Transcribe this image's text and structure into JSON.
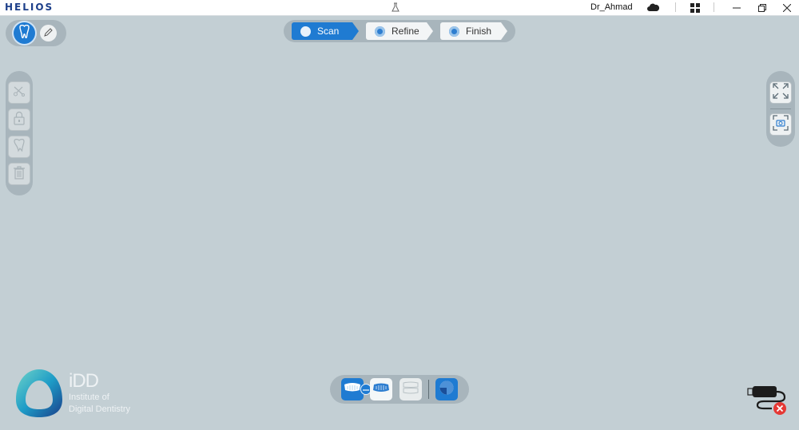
{
  "app": {
    "logo_text": "HELIOS",
    "username": "Dr_Ahmad"
  },
  "workflow": {
    "steps": [
      {
        "label": "Scan",
        "active": true
      },
      {
        "label": "Refine",
        "active": false
      },
      {
        "label": "Finish",
        "active": false
      }
    ]
  },
  "branding": {
    "title": "iDD",
    "line1": "Institute of",
    "line2": "Digital Dentistry"
  },
  "colors": {
    "background": "#c3cfd4",
    "panel": "#a8b5bc",
    "accent_blue": "#1e7ad0",
    "disconnect_red": "#e53935"
  },
  "icons": {
    "top_left": [
      "tooth-icon",
      "pencil-icon"
    ],
    "left_tools": [
      "scissors-icon",
      "lock-icon",
      "tooth-edit-icon",
      "trash-icon"
    ],
    "right_tools": [
      "fullscreen-icon",
      "screenshot-icon"
    ],
    "bottom_tools": [
      "upper-jaw-icon",
      "link-icon",
      "lower-jaw-icon",
      "bite-icon",
      "analysis-icon"
    ],
    "status": "scanner-disconnected-icon"
  }
}
